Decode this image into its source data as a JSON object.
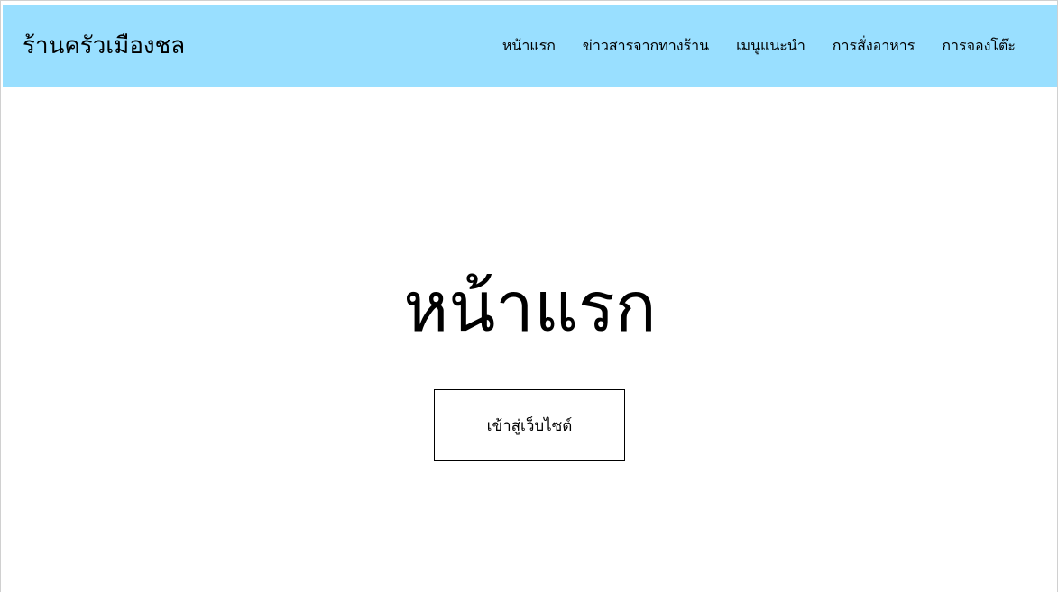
{
  "header": {
    "brand": "ร้านครัวเมืองชล",
    "nav": [
      {
        "label": "หน้าแรก"
      },
      {
        "label": "ข่าวสารจากทางร้าน"
      },
      {
        "label": "เมนูแนะนำ"
      },
      {
        "label": "การสั่งอาหาร"
      },
      {
        "label": "การจองโต๊ะ"
      }
    ],
    "bg_color": "#99dfff"
  },
  "hero": {
    "title": "หน้าแรก",
    "button_label": "เข้าสู่เว็บไซต์"
  }
}
